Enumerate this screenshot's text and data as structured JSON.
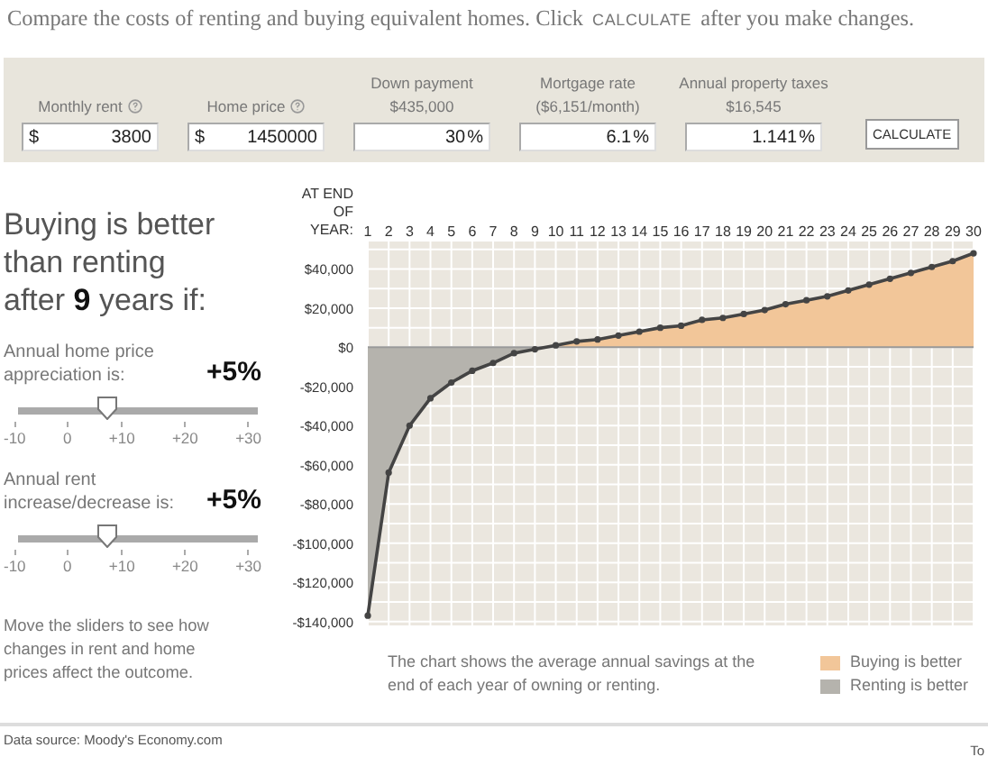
{
  "intro": {
    "text_before": "Compare the costs of renting and buying equivalent homes. Click",
    "keyword": "CALCULATE",
    "text_after": "after you make changes."
  },
  "inputs": [
    {
      "label": "Monthly rent",
      "help": true,
      "prefix": "$",
      "value": "3800"
    },
    {
      "label": "Home price",
      "help": true,
      "prefix": "$",
      "value": "1450000"
    },
    {
      "label": "Down payment",
      "note": "$435,000",
      "help": false,
      "value": "30",
      "suffix": "%"
    },
    {
      "label": "Mortgage rate",
      "note": "($6,151/month)",
      "help": false,
      "value": "6.1",
      "suffix": "%"
    },
    {
      "label": "Annual property taxes",
      "note": "$16,545",
      "help": false,
      "value": "1.141",
      "suffix": "%"
    }
  ],
  "calculate_button": "CALCULATE",
  "headline": "Buying is better than renting after **9** years if:",
  "sliders": [
    {
      "label": "Annual home price appreciation is:",
      "reading": "+5%",
      "level": 0.375,
      "ticks": [
        "-10",
        "0",
        "+10",
        "+20",
        "+30"
      ]
    },
    {
      "label": "Annual rent increase/decrease is:",
      "reading": "+5%",
      "level": 0.375,
      "ticks": [
        "-10",
        "0",
        "+10",
        "+20",
        "+30"
      ]
    }
  ],
  "slider_note": "Move the sliders to see how changes in rent and home prices affect the outcome.",
  "chart": {
    "chart_data": {
      "type": "area",
      "xlabel": "AT END OF YEAR:",
      "x": [
        1,
        2,
        3,
        4,
        5,
        6,
        7,
        8,
        9,
        10,
        11,
        12,
        13,
        14,
        15,
        16,
        17,
        18,
        19,
        20,
        21,
        22,
        23,
        24,
        25,
        26,
        27,
        28,
        29,
        30
      ],
      "series": [
        {
          "color": "#444444",
          "values": [
            -137000,
            -64000,
            -40000,
            -26000,
            -18000,
            -12000,
            -8000,
            -3000,
            -1000,
            1000,
            3000,
            4000,
            6000,
            8000,
            10000,
            11000,
            14000,
            15000,
            17000,
            19000,
            22000,
            24000,
            26000,
            29000,
            32000,
            35000,
            38000,
            41000,
            44000,
            48000
          ]
        }
      ],
      "xlim": [
        1,
        30
      ],
      "ylim": [
        -142000,
        54000
      ],
      "grid": true,
      "xticks": [
        1,
        2,
        3,
        4,
        5,
        6,
        7,
        8,
        9,
        10,
        11,
        12,
        13,
        14,
        15,
        16,
        17,
        18,
        19,
        20,
        21,
        22,
        23,
        24,
        25,
        26,
        27,
        28,
        29,
        30
      ],
      "yticks": [
        {
          "value": 40000,
          "label": "$40,000"
        },
        {
          "value": 20000,
          "label": "$20,000"
        },
        {
          "value": 0,
          "label": "$0"
        },
        {
          "value": -20000,
          "label": "-$20,000"
        },
        {
          "value": -40000,
          "label": "-$40,000"
        },
        {
          "value": -60000,
          "label": "-$60,000"
        },
        {
          "value": -80000,
          "label": "-$80,000"
        },
        {
          "value": -100000,
          "label": "-$100,000"
        },
        {
          "value": -120000,
          "label": "-$120,000"
        },
        {
          "value": -140000,
          "label": "-$140,000"
        }
      ]
    },
    "caption": "The chart shows the average annual savings at the end of each year of owning or renting.",
    "legend": [
      {
        "kind": "above",
        "label": "Buying is better",
        "color": "#f2c699"
      },
      {
        "kind": "below",
        "label": "Renting is better",
        "color": "#b5b3ad"
      }
    ]
  },
  "footer": {
    "source": "Data source: Moody's Economy.com",
    "right_text": "To"
  }
}
